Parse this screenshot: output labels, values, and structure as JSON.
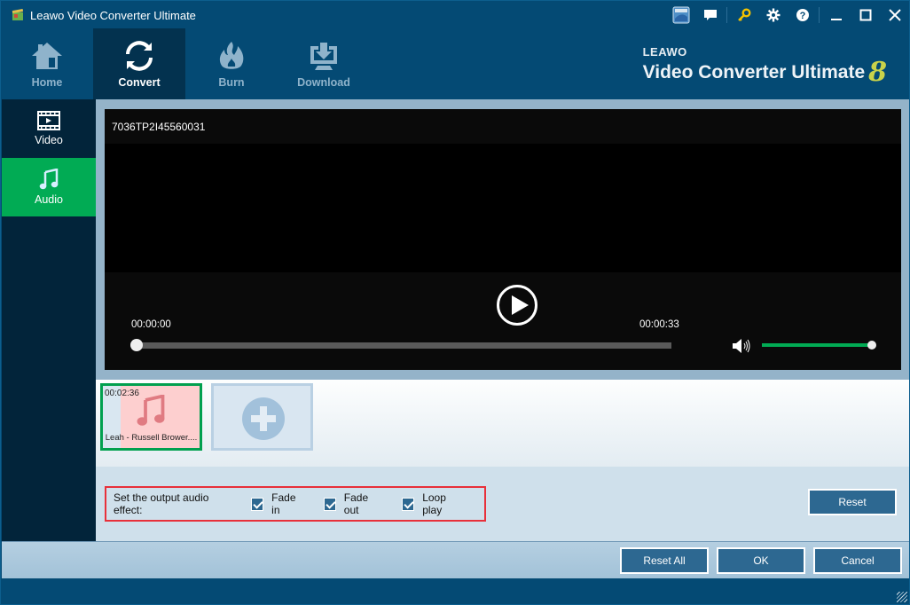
{
  "window": {
    "title": "Leawo Video Converter Ultimate",
    "controls": {
      "support_icon": "support-badge-icon",
      "feedback_icon": "chat-bubble-icon",
      "register_icon": "key-icon",
      "settings_icon": "gear-icon",
      "help_icon": "help-icon",
      "minimize_icon": "minimize-icon",
      "maximize_icon": "maximize-icon",
      "close_icon": "close-icon"
    }
  },
  "nav": {
    "items": [
      {
        "label": "Home",
        "icon": "home-icon",
        "active": false
      },
      {
        "label": "Convert",
        "icon": "convert-icon",
        "active": true
      },
      {
        "label": "Burn",
        "icon": "flame-icon",
        "active": false
      },
      {
        "label": "Download",
        "icon": "download-icon",
        "active": false
      }
    ]
  },
  "brand": {
    "company": "LEAWO",
    "product": "Video Converter Ultimate",
    "version": "8"
  },
  "sidebar": {
    "items": [
      {
        "label": "Video",
        "icon": "film-icon",
        "active": false
      },
      {
        "label": "Audio",
        "icon": "music-note-icon",
        "active": true
      }
    ]
  },
  "player": {
    "file_title": "7036TP2I45560031",
    "current_time": "00:00:00",
    "total_time": "00:00:33",
    "seek_progress": 0,
    "volume": 1.0
  },
  "clips": [
    {
      "duration": "00:02:36",
      "name": "Leah - Russell Brower....",
      "selected": true
    }
  ],
  "effects": {
    "label": "Set the output audio effect:",
    "options": [
      {
        "label": "Fade in",
        "checked": true
      },
      {
        "label": "Fade out",
        "checked": true
      },
      {
        "label": "Loop play",
        "checked": true
      }
    ],
    "reset_label": "Reset"
  },
  "footer": {
    "reset_all_label": "Reset All",
    "ok_label": "OK",
    "cancel_label": "Cancel"
  },
  "colors": {
    "accent_green": "#01ab54",
    "title_bar": "#044a74",
    "button_blue": "#2d6891",
    "highlight_red": "#e8303a"
  }
}
